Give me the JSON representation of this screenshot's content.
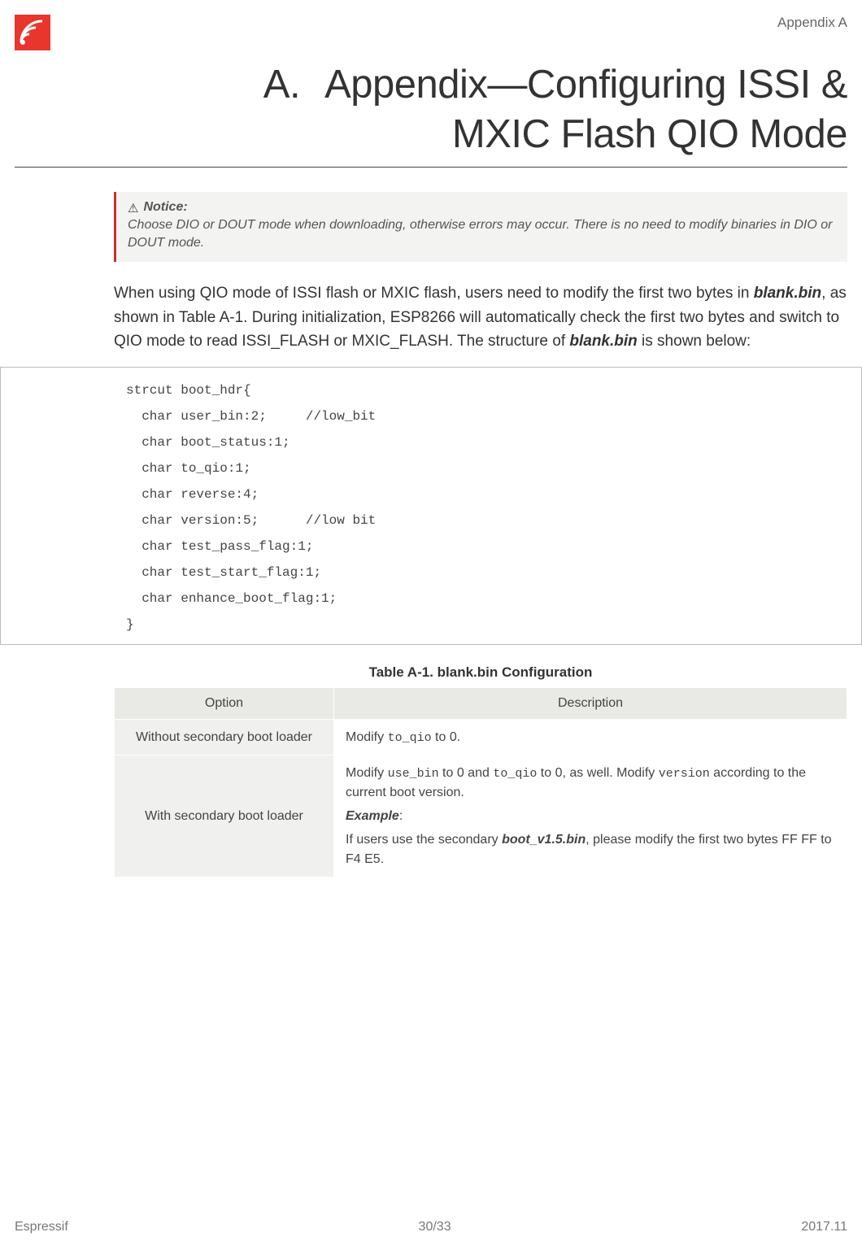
{
  "header": {
    "appendix_label": "Appendix A"
  },
  "title": {
    "prefix": "A.",
    "line1": "Appendix—Configuring ISSI &",
    "line2": "MXIC Flash QIO Mode"
  },
  "notice": {
    "icon": "⚠",
    "label": "Notice:",
    "text": "Choose DIO or DOUT mode when downloading, otherwise errors may occur. There is no need to modify binaries in DIO or DOUT mode."
  },
  "body": {
    "p1_pre": "When using QIO mode of ISSI flash or MXIC flash, users need to modify the first two bytes in ",
    "p1_file1": "blank.bin",
    "p1_mid": ", as shown in Table A-1. During initialization, ESP8266 will automatically check the first two bytes and switch to QIO mode to read ISSI_FLASH or MXIC_FLASH. The structure of ",
    "p1_file2": "blank.bin",
    "p1_post": " is shown below:"
  },
  "code": "strcut boot_hdr{\n  char user_bin:2;     //low_bit\n  char boot_status:1;\n  char to_qio:1;\n  char reverse:4;\n  char version:5;      //low bit\n  char test_pass_flag:1;\n  char test_start_flag:1;\n  char enhance_boot_flag:1;\n}",
  "table": {
    "caption": "Table A-1. blank.bin Configuration",
    "headers": {
      "opt": "Option",
      "desc": "Description"
    },
    "row1": {
      "opt": "Without secondary boot loader",
      "desc_pre": "Modify ",
      "desc_code": "to_qio",
      "desc_post": " to 0."
    },
    "row2": {
      "opt": "With secondary boot loader",
      "line1_pre": "Modify ",
      "line1_c1": "use_bin",
      "line1_mid1": " to 0 and ",
      "line1_c2": "to_qio",
      "line1_mid2": " to 0, as well. Modify ",
      "line1_c3": "version",
      "line1_post": " according to the current boot version.",
      "example_label": "Example",
      "example_colon": ":",
      "line2_pre": "If users use the secondary ",
      "line2_file": "boot_v1.5.bin",
      "line2_post": ", please modify the first two bytes FF FF to F4 E5."
    }
  },
  "footer": {
    "left": "Espressif",
    "center": "30/33",
    "right": "2017.11"
  }
}
